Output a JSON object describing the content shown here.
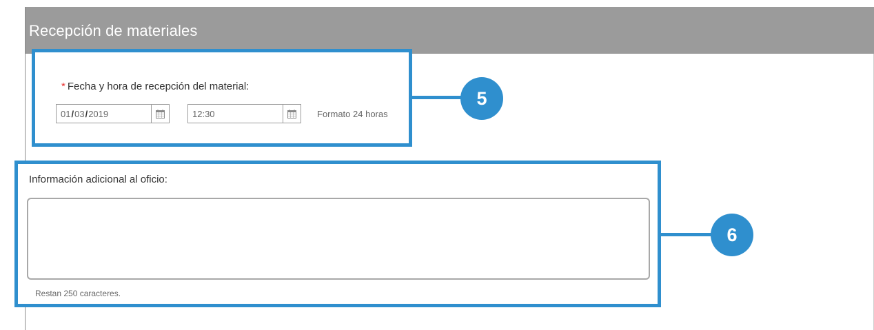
{
  "header": {
    "title": "Recepción de materiales"
  },
  "reception": {
    "required_mark": "*",
    "label": "Fecha y hora de recepción del material:",
    "date": {
      "day": "01",
      "month": "03",
      "year": "2019",
      "separator": "/"
    },
    "time": "12:30",
    "helper": "Formato 24 horas",
    "calendar_icon": "calendar-icon"
  },
  "additional_info": {
    "label": "Información adicional al oficio:",
    "value": "",
    "char_count": "Restan 250 caracteres."
  },
  "callouts": {
    "first": "5",
    "second": "6"
  },
  "colors": {
    "header": "#9b9b9b",
    "callout": "#2f8fce",
    "required": "#e8312f"
  }
}
